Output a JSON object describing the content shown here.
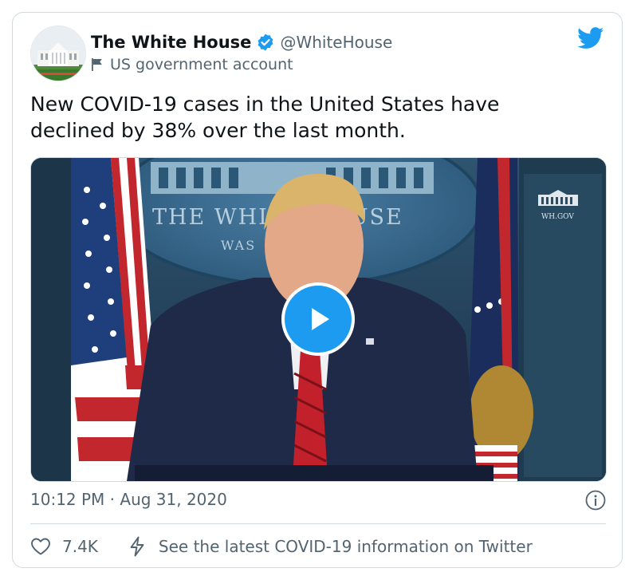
{
  "tweet": {
    "display_name": "The White House",
    "handle": "@WhiteHouse",
    "account_label": "US government account",
    "text": "New COVID-19 cases in the United States have declined by 38% over the last month.",
    "timestamp": "10:12 PM · Aug 31, 2020",
    "likes": "7.4K",
    "covid_link": "See the latest COVID-19 information on Twitter"
  },
  "media": {
    "seal_text_1": "THE WHITE HOUSE",
    "seal_text_2": "WAS",
    "logo_text": "WH.GOV"
  },
  "icons": {
    "verified": "verified-badge-icon",
    "label": "flag-icon",
    "brand": "twitter-bird-icon",
    "play": "play-icon",
    "info": "info-icon",
    "like": "heart-icon",
    "covid": "lightning-icon"
  },
  "colors": {
    "accent": "#1d9bf0",
    "text": "#0f1419",
    "secondary": "#536471",
    "border": "#cfd9de"
  }
}
